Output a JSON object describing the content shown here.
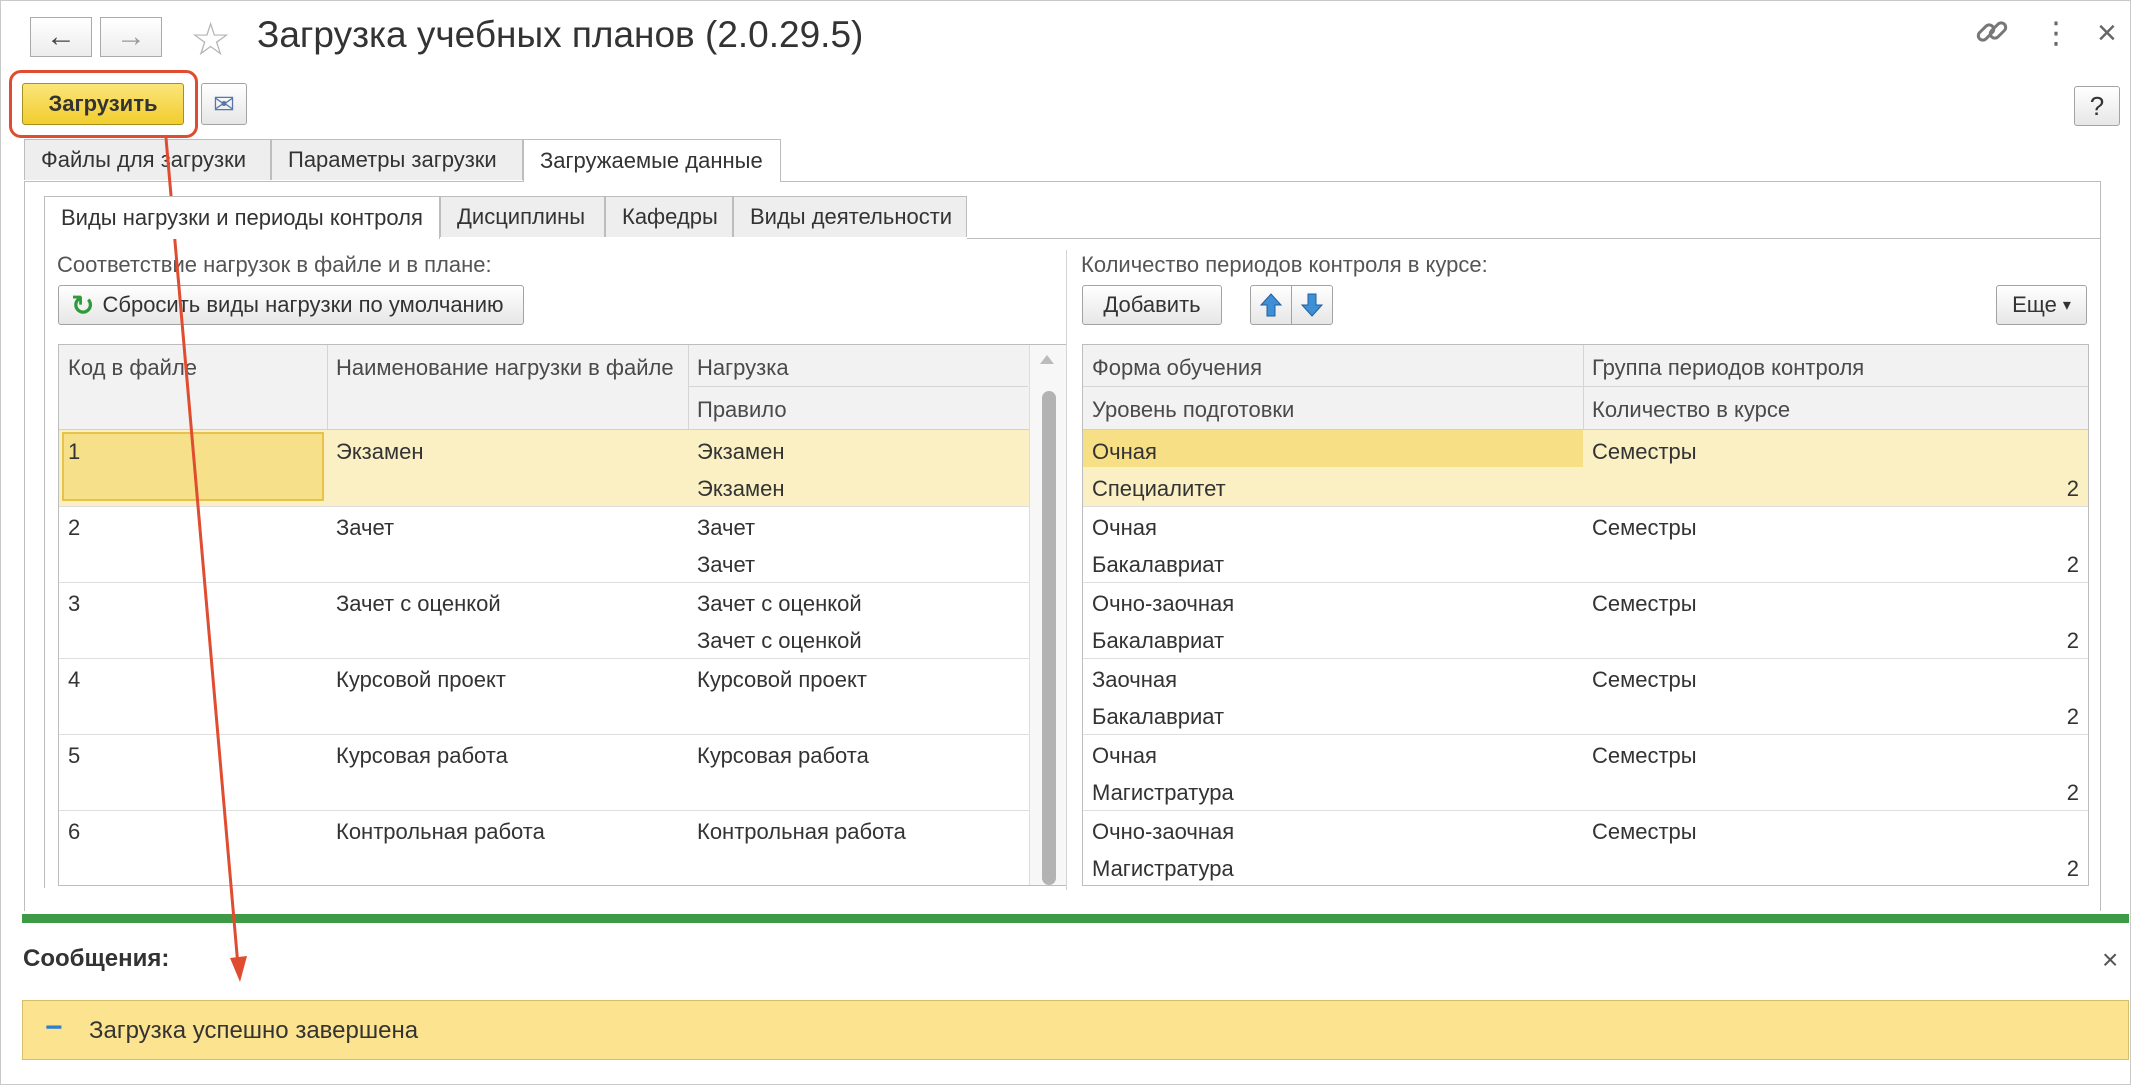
{
  "window": {
    "title": "Загрузка учебных планов (2.0.29.5)",
    "back_icon": "←",
    "forward_icon": "→",
    "star_icon": "☆",
    "link_icon": "🔗",
    "more_icon": "⋮",
    "close_icon": "×"
  },
  "toolbar": {
    "load_label": "Загрузить",
    "mail_icon": "✉",
    "help_label": "?"
  },
  "main_tabs": [
    {
      "label": "Файлы для загрузки"
    },
    {
      "label": "Параметры загрузки"
    },
    {
      "label": "Загружаемые данные"
    }
  ],
  "sub_tabs": [
    {
      "label": "Виды нагрузки и периоды контроля"
    },
    {
      "label": "Дисциплины"
    },
    {
      "label": "Кафедры"
    },
    {
      "label": "Виды деятельности"
    }
  ],
  "left_panel": {
    "caption": "Соответствие нагрузок в файле и в плане:",
    "reset_button_label": "Сбросить виды нагрузки по умолчанию",
    "reset_icon": "↻",
    "headers": {
      "code": "Код в файле",
      "name": "Наименование нагрузки в файле",
      "load": "Нагрузка",
      "rule": "Правило"
    },
    "rows": [
      {
        "code": "1",
        "name": "Экзамен",
        "load": "Экзамен",
        "rule": "Экзамен"
      },
      {
        "code": "2",
        "name": "Зачет",
        "load": "Зачет",
        "rule": "Зачет"
      },
      {
        "code": "3",
        "name": "Зачет с оценкой",
        "load": "Зачет с оценкой",
        "rule": "Зачет с оценкой"
      },
      {
        "code": "4",
        "name": "Курсовой проект",
        "load": "Курсовой проект",
        "rule": ""
      },
      {
        "code": "5",
        "name": "Курсовая работа",
        "load": "Курсовая работа",
        "rule": ""
      },
      {
        "code": "6",
        "name": "Контрольная работа",
        "load": "Контрольная работа",
        "rule": ""
      }
    ],
    "selected_row": 0
  },
  "right_panel": {
    "caption": "Количество периодов контроля в курсе:",
    "add_button_label": "Добавить",
    "up_icon": "🡅",
    "down_icon": "🡇",
    "more_button_label": "Еще",
    "more_chevron": "▾",
    "headers": {
      "form": "Форма обучения",
      "group": "Группа периодов контроля",
      "level": "Уровень подготовки",
      "count": "Количество в курсе"
    },
    "rows": [
      {
        "form": "Очная",
        "group": "Семестры",
        "level": "Специалитет",
        "count": "2"
      },
      {
        "form": "Очная",
        "group": "Семестры",
        "level": "Бакалавриат",
        "count": "2"
      },
      {
        "form": "Очно-заочная",
        "group": "Семестры",
        "level": "Бакалавриат",
        "count": "2"
      },
      {
        "form": "Заочная",
        "group": "Семестры",
        "level": "Бакалавриат",
        "count": "2"
      },
      {
        "form": "Очная",
        "group": "Семестры",
        "level": "Магистратура",
        "count": "2"
      },
      {
        "form": "Очно-заочная",
        "group": "Семестры",
        "level": "Магистратура",
        "count": "2"
      }
    ],
    "selected_row": 0
  },
  "messages": {
    "title": "Сообщения:",
    "close_icon": "×",
    "items": [
      {
        "icon": "−",
        "text": "Загрузка успешно завершена"
      }
    ]
  },
  "colors": {
    "accent_button": "#f1cd2e",
    "selection": "#fbf0c4",
    "message_bg": "#fbe38f",
    "separator": "#3f9a47",
    "annotation": "#e04c2f"
  }
}
